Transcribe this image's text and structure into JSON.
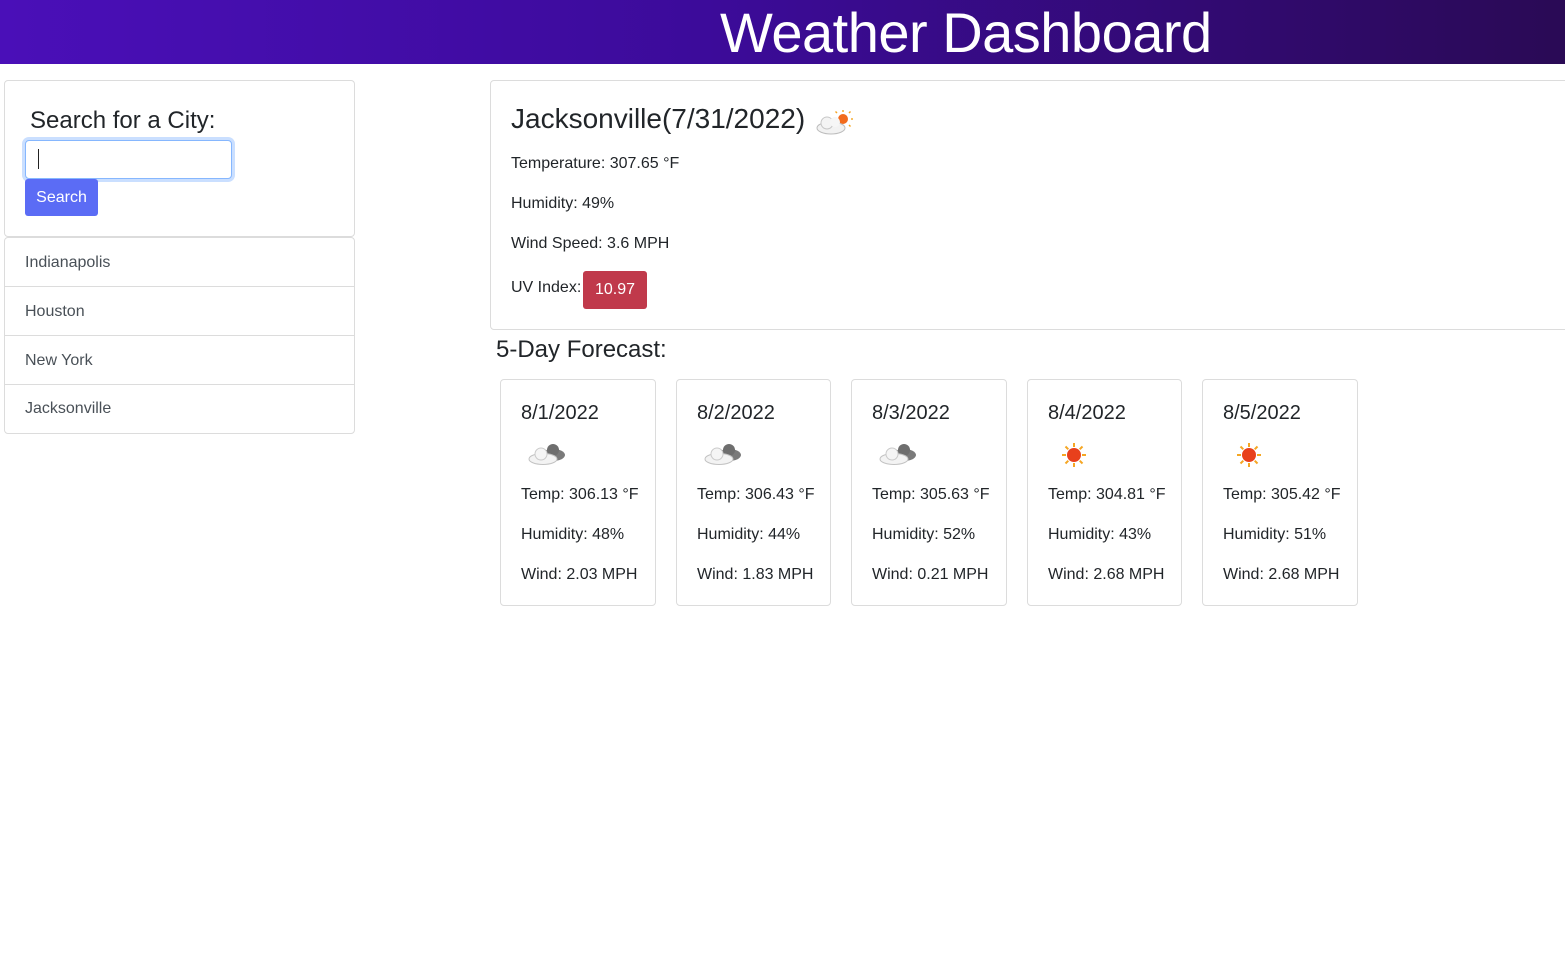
{
  "header": {
    "title": "Weather Dashboard"
  },
  "sidebar": {
    "search_heading": "Search for a City:",
    "search_input": {
      "value": "",
      "placeholder": ""
    },
    "search_button": "Search",
    "history": [
      "Indianapolis",
      "Houston",
      "New York",
      "Jacksonville"
    ]
  },
  "current": {
    "city_date": "Jacksonville(7/31/2022)",
    "icon": "cloud-sun-icon",
    "temperature": "Temperature: 307.65 °F",
    "humidity": "Humidity: 49%",
    "wind": "Wind Speed: 3.6 MPH",
    "uv_label": "UV Index:",
    "uv_value": "10.97",
    "uv_color": "#c0394b"
  },
  "forecast": {
    "heading": "5-Day Forecast:",
    "days": [
      {
        "date": "8/1/2022",
        "icon": "cloudy-icon",
        "temp": "Temp: 306.13 °F",
        "humidity": "Humidity: 48%",
        "wind": "Wind: 2.03 MPH"
      },
      {
        "date": "8/2/2022",
        "icon": "cloudy-icon",
        "temp": "Temp: 306.43 °F",
        "humidity": "Humidity: 44%",
        "wind": "Wind: 1.83 MPH"
      },
      {
        "date": "8/3/2022",
        "icon": "cloudy-icon",
        "temp": "Temp: 305.63 °F",
        "humidity": "Humidity: 52%",
        "wind": "Wind: 0.21 MPH"
      },
      {
        "date": "8/4/2022",
        "icon": "sun-icon",
        "temp": "Temp: 304.81 °F",
        "humidity": "Humidity: 43%",
        "wind": "Wind: 2.68 MPH"
      },
      {
        "date": "8/5/2022",
        "icon": "sun-icon",
        "temp": "Temp: 305.42 °F",
        "humidity": "Humidity: 51%",
        "wind": "Wind: 2.68 MPH"
      }
    ]
  },
  "colors": {
    "header_gradient_start": "#4a0fb8",
    "header_gradient_end": "#2a0a55",
    "search_button": "#5b6cf5",
    "uv_badge": "#c0394b"
  }
}
